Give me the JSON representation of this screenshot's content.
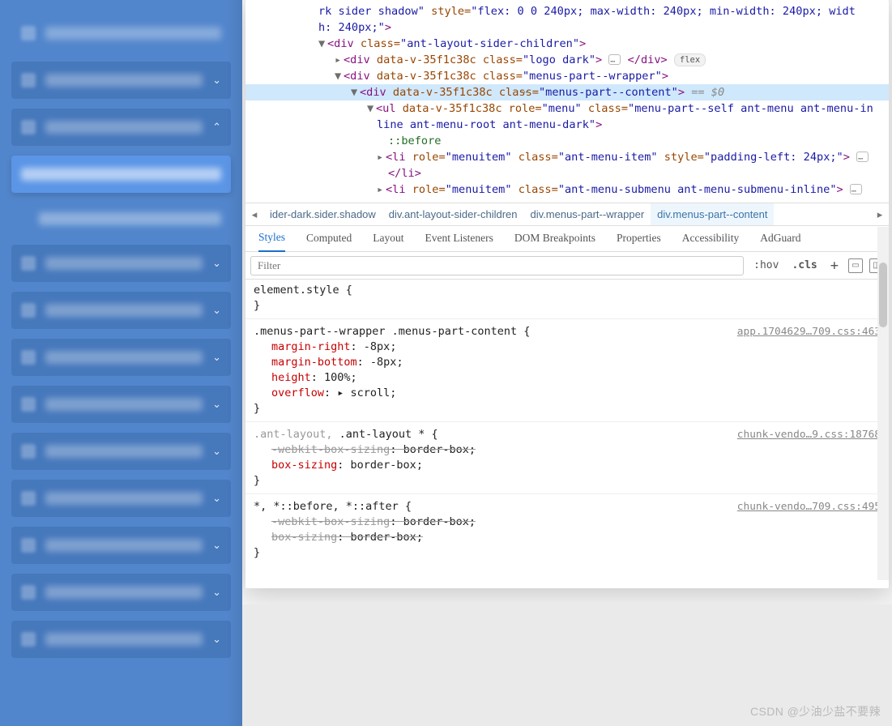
{
  "sidebar": {
    "items": [
      {
        "chev": "",
        "type": "plain"
      },
      {
        "chev": "⌄",
        "type": "norm"
      },
      {
        "chev": "⌃",
        "type": "norm open"
      },
      {
        "chev": "",
        "type": "selected"
      },
      {
        "chev": "",
        "type": "child"
      },
      {
        "chev": "⌄",
        "type": "norm"
      },
      {
        "chev": "⌄",
        "type": "norm"
      },
      {
        "chev": "⌄",
        "type": "norm"
      },
      {
        "chev": "⌄",
        "type": "norm"
      },
      {
        "chev": "⌄",
        "type": "norm"
      },
      {
        "chev": "⌄",
        "type": "norm"
      },
      {
        "chev": "⌄",
        "type": "norm"
      },
      {
        "chev": "⌄",
        "type": "norm"
      },
      {
        "chev": "⌄",
        "type": "norm"
      }
    ]
  },
  "dom": {
    "line0a": "rk sider shadow\"",
    "line0b": " style=",
    "line0c": "\"flex: 0 0 240px; max-width: 240px; min-width: 240px; widt",
    "line0d": "h: 240px;\"",
    "line0e": ">",
    "line1_class": "\"ant-layout-sider-children\"",
    "line2_class": "\"logo dark\"",
    "line2_flex": "flex",
    "line3_class": "\"menus-part--wrapper\"",
    "line4_class": "\"menus-part--content\"",
    "line4_eq": " == $0",
    "line5_role": "\"menu\"",
    "line5_class": "\"menu-part--self ant-menu ant-menu-in",
    "line5b": "line ant-menu-root ant-menu-dark\"",
    "line6": "::before",
    "line7_role": "\"menuitem\"",
    "line7_class": "\"ant-menu-item\"",
    "line7_style": "\"padding-left: 24px;\"",
    "line8": "</li>",
    "line9_role": "\"menuitem\"",
    "line9_class": "\"ant-menu-submenu ant-menu-submenu-inline\"",
    "linez": "       …"
  },
  "crumbs": {
    "left_arrow": "◂",
    "right_arrow": "▸",
    "c1": "ider-dark.sider.shadow",
    "c2": "div.ant-layout-sider-children",
    "c3": "div.menus-part--wrapper",
    "c4": "div.menus-part--content"
  },
  "tabs": {
    "t1": "Styles",
    "t2": "Computed",
    "t3": "Layout",
    "t4": "Event Listeners",
    "t5": "DOM Breakpoints",
    "t6": "Properties",
    "t7": "Accessibility",
    "t8": "AdGuard"
  },
  "toolbar": {
    "filter_ph": "Filter",
    "hov": ":hov",
    "cls": ".cls"
  },
  "styles_panel": {
    "r0_sel": "element.style {",
    "r0_close": "}",
    "r1_sel": ".menus-part--wrapper .menus-part-content {",
    "r1_src": "app.1704629…709.css:463",
    "r1_p1n": "margin-right",
    "r1_p1v": ": -8px;",
    "r1_p2n": "margin-bottom",
    "r1_p2v": ": -8px;",
    "r1_p3n": "height",
    "r1_p3v": ": 100%;",
    "r1_p4n": "overflow",
    "r1_p4v": ": ▸ scroll;",
    "r1_close": "}",
    "r2_sel_dim": ".ant-layout, ",
    "r2_sel": ".ant-layout * {",
    "r2_src": "chunk-vendo…9.css:18768",
    "r2_p1n": "-webkit-box-sizing",
    "r2_p1v": ": border-box;",
    "r2_p2n": "box-sizing",
    "r2_p2v": ": border-box;",
    "r2_close": "}",
    "r3_sel": "*, *::before, *::after {",
    "r3_src": "chunk-vendo…709.css:495",
    "r3_p1n": "-webkit-box-sizing",
    "r3_p1v": ": border-box;",
    "r3_p2n": "box-sizing",
    "r3_p2v": ": border-box;",
    "r3_close": "}"
  },
  "watermark": "CSDN @少油少盐不要辣"
}
